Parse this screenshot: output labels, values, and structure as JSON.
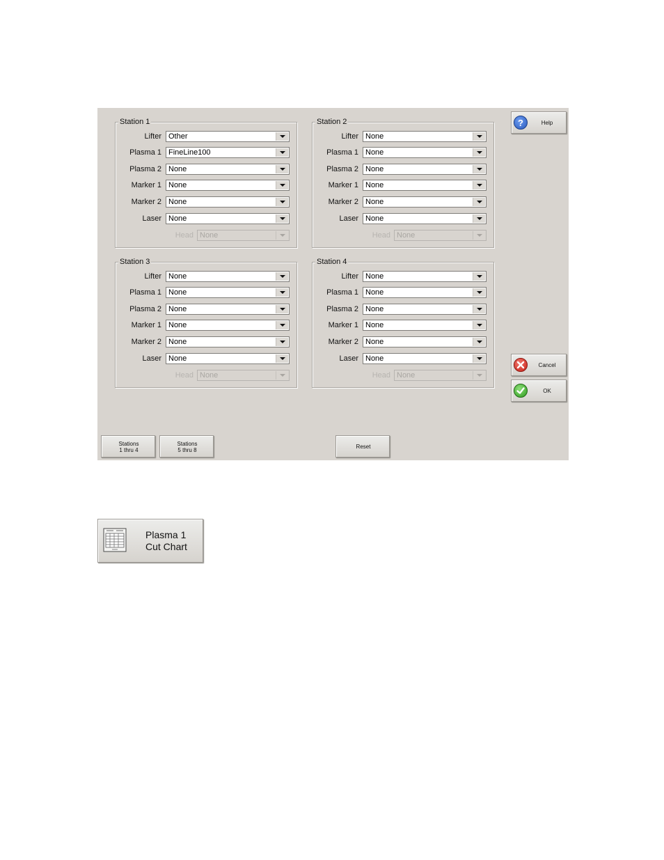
{
  "stations": [
    {
      "title": "Station 1",
      "rows": [
        {
          "label": "Lifter",
          "value": "Other"
        },
        {
          "label": "Plasma 1",
          "value": "FineLine100"
        },
        {
          "label": "Plasma 2",
          "value": "None"
        },
        {
          "label": "Marker 1",
          "value": "None"
        },
        {
          "label": "Marker 2",
          "value": "None"
        },
        {
          "label": "Laser",
          "value": "None"
        }
      ],
      "head": {
        "label": "Head",
        "value": "None"
      }
    },
    {
      "title": "Station 2",
      "rows": [
        {
          "label": "Lifter",
          "value": "None"
        },
        {
          "label": "Plasma 1",
          "value": "None"
        },
        {
          "label": "Plasma 2",
          "value": "None"
        },
        {
          "label": "Marker 1",
          "value": "None"
        },
        {
          "label": "Marker 2",
          "value": "None"
        },
        {
          "label": "Laser",
          "value": "None"
        }
      ],
      "head": {
        "label": "Head",
        "value": "None"
      }
    },
    {
      "title": "Station 3",
      "rows": [
        {
          "label": "Lifter",
          "value": "None"
        },
        {
          "label": "Plasma 1",
          "value": "None"
        },
        {
          "label": "Plasma 2",
          "value": "None"
        },
        {
          "label": "Marker 1",
          "value": "None"
        },
        {
          "label": "Marker 2",
          "value": "None"
        },
        {
          "label": "Laser",
          "value": "None"
        }
      ],
      "head": {
        "label": "Head",
        "value": "None"
      }
    },
    {
      "title": "Station 4",
      "rows": [
        {
          "label": "Lifter",
          "value": "None"
        },
        {
          "label": "Plasma 1",
          "value": "None"
        },
        {
          "label": "Plasma 2",
          "value": "None"
        },
        {
          "label": "Marker 1",
          "value": "None"
        },
        {
          "label": "Marker 2",
          "value": "None"
        },
        {
          "label": "Laser",
          "value": "None"
        }
      ],
      "head": {
        "label": "Head",
        "value": "None"
      }
    }
  ],
  "buttons": {
    "help": "Help",
    "cancel": "Cancel",
    "ok": "OK",
    "stations_1_4_line1": "Stations",
    "stations_1_4_line2": "1 thru 4",
    "stations_5_8_line1": "Stations",
    "stations_5_8_line2": "5 thru 8",
    "reset": "Reset"
  },
  "cut_chart_button": {
    "line1": "Plasma 1",
    "line2": "Cut Chart",
    "icon": "table-icon"
  },
  "icons": {
    "help": "question-icon",
    "cancel": "x-icon",
    "ok": "check-icon"
  },
  "colors": {
    "panel_bg": "#d8d4cf",
    "help_blue": "#2a5bbd",
    "cancel_red": "#d22a20",
    "ok_green": "#3ea52a"
  }
}
